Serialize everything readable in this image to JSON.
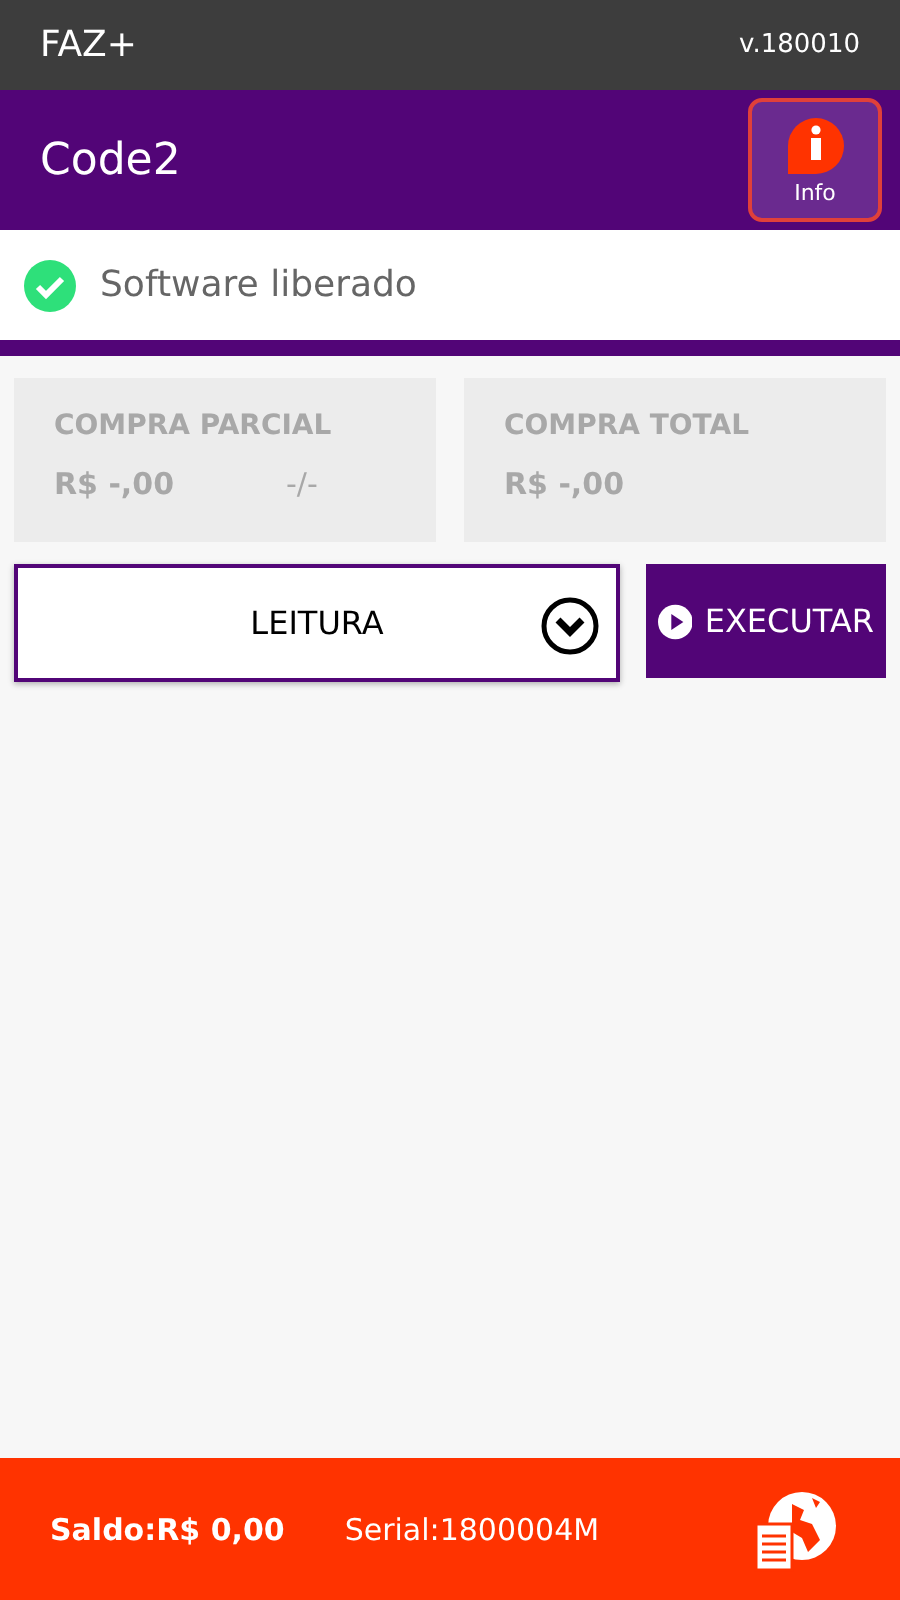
{
  "status_bar": {
    "app_name": "FAZ+",
    "version": "v.180010"
  },
  "header": {
    "title": "Code2",
    "info_button": {
      "label": "Info"
    }
  },
  "license": {
    "text": "Software liberado",
    "ok": true
  },
  "cards": [
    {
      "title": "COMPRA PARCIAL",
      "value": "R$ -,00",
      "extra": "-/-",
      "disabled": true
    },
    {
      "title": "COMPRA TOTAL",
      "value": "R$ -,00",
      "disabled": true
    }
  ],
  "operation_select": {
    "value": "LEITURA"
  },
  "execute_button": {
    "label": "EXECUTAR"
  },
  "footer": {
    "balance": "Saldo:R$ 0,00",
    "serial": "Serial:1800004M"
  }
}
